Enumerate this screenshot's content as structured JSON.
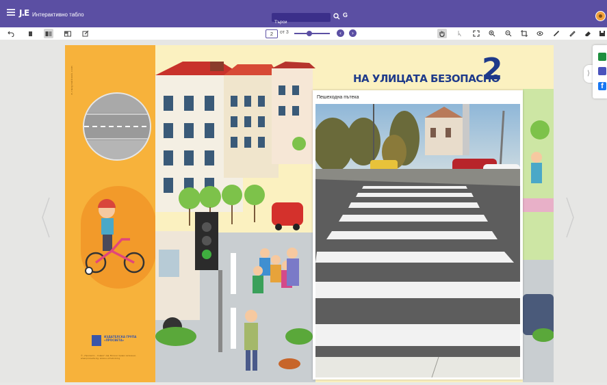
{
  "app": {
    "title": "Интерактивно табло",
    "logo": "Ј.Е"
  },
  "search": {
    "placeholder": "Търси",
    "button_label": "G"
  },
  "toolbar": {
    "current_page": "2",
    "page_of": "от 3",
    "zoom_level": 0.42,
    "left_tools": [
      "undo-icon",
      "single-page-icon",
      "double-page-icon",
      "grid-page-icon",
      "edit-note-icon"
    ],
    "right_tools": [
      "hand-icon",
      "pointer-icon",
      "fullscreen-icon",
      "zoom-in-icon",
      "zoom-out-icon",
      "crop-icon",
      "eye-icon",
      "pen-icon",
      "marker-icon",
      "eraser-icon",
      "save-icon"
    ]
  },
  "page": {
    "lesson_title": "НА УЛИЦАТА БЕЗОПАСНО",
    "lesson_number": "2",
    "photo_caption": "Пешеходна пътека",
    "publisher_logo_text": "ИЗДАТЕЛСКА ГРУПА «ПРОСВЕТА»",
    "vertical_credit": "e-razgradbook.com",
    "legal_text": "© „Просвета – София“ АД, Всички права запазени, www.prosveta.bg, www.e-uchebnik.bg"
  },
  "share": {
    "icons": [
      "google-classroom-icon",
      "teams-icon",
      "facebook-icon"
    ],
    "colors": {
      "classroom": "#1e8e3e",
      "teams": "#4b53bc",
      "facebook": "#1877f2"
    }
  },
  "colors": {
    "topbar": "#5b4fa3",
    "accent": "#5b4fa3",
    "title_blue": "#1e3a8a",
    "orange": "#f7b23b"
  }
}
